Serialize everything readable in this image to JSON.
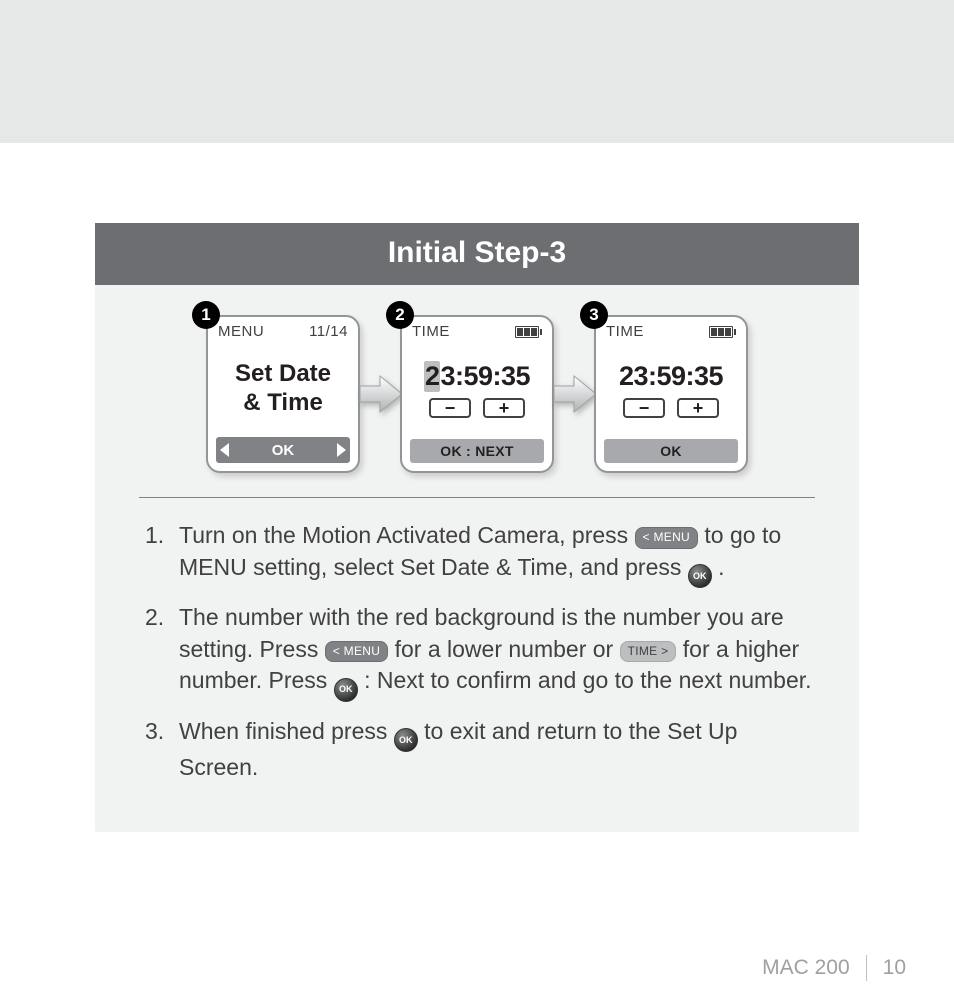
{
  "header": {
    "title": "Initial Step-3"
  },
  "screens": {
    "s1": {
      "badge": "1",
      "top_left": "MENU",
      "top_right": "11/14",
      "line1": "Set Date",
      "line2": "& Time",
      "footer_ok": "OK"
    },
    "s2": {
      "badge": "2",
      "top_left": "TIME",
      "time_hl": "2",
      "time_rest": "3:59:35",
      "minus": "−",
      "plus": "+",
      "footer": "OK : NEXT"
    },
    "s3": {
      "badge": "3",
      "top_left": "TIME",
      "time": "23:59:35",
      "minus": "−",
      "plus": "+",
      "footer": "OK"
    }
  },
  "buttons": {
    "menu": "< MENU",
    "time": "TIME >",
    "ok": "OK"
  },
  "steps": {
    "s1a": "Turn on the Motion Activated Camera, press ",
    "s1b": " to go to MENU setting, select Set Date & Time, and press ",
    "s1c": " .",
    "s2a": "The number with the red background is the number you are setting. Press ",
    "s2b": " for a lower number or ",
    "s2c": " for a higher number. Press ",
    "s2d": " : Next to confirm and go to the next number.",
    "s3a": "When finished press ",
    "s3b": " to exit and return to the Set Up Screen."
  },
  "footer": {
    "model": "MAC 200",
    "page": "10"
  }
}
